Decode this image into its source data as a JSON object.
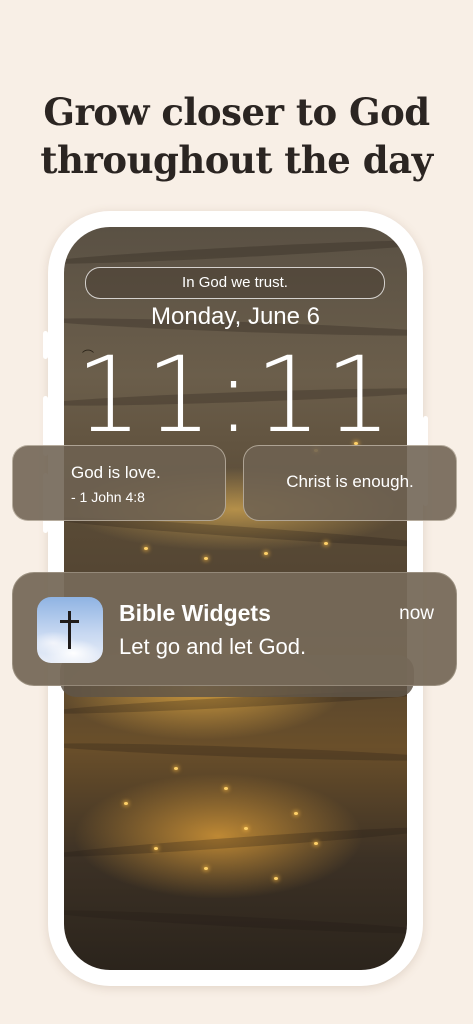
{
  "headline": {
    "line1": "Grow closer to God",
    "line2": "throughout the day"
  },
  "lock_screen": {
    "widget_pill": "In God we trust.",
    "date": "Monday, June 6",
    "time": "11:11"
  },
  "widgets": [
    {
      "line1": "God is love.",
      "line2": "- 1 John 4:8"
    },
    {
      "text": "Christ is enough."
    }
  ],
  "notification": {
    "app_name": "Bible Widgets",
    "time": "now",
    "body": "Let go and let God.",
    "icon": "cross-icon"
  },
  "colors": {
    "background": "#f8efe6",
    "headline": "#2b2522",
    "phone_frame": "#ffffff"
  }
}
